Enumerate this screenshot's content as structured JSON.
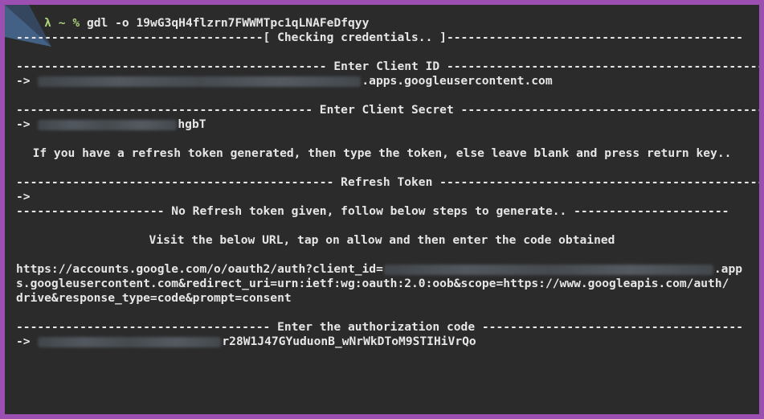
{
  "prompt": {
    "lambda": "λ",
    "tilde": "~",
    "percent": "%",
    "command": "gdl -o 19wG3qH4flzrn7FWWMTpc1qLNAFeDfqyy"
  },
  "lines": {
    "checking": "-----------------------------------[ Checking credentials.. ]------------------------------------------",
    "client_id_header": "-------------------------------------------- Enter Client ID ----------------------------------------------",
    "client_id_suffix": ".apps.googleusercontent.com",
    "client_secret_header": "------------------------------------------ Enter Client Secret --------------------------------------------",
    "client_secret_suffix": "hgbT",
    "refresh_hint": "If you have a refresh token generated, then type the token, else leave blank and press return key..",
    "refresh_header": "--------------------------------------------- Refresh Token ----------------------------------------------",
    "no_refresh": "--------------------- No Refresh token given, follow below steps to generate.. ----------------------",
    "visit_url": "Visit the below URL, tap on allow and then enter the code obtained",
    "url_line1_prefix": "https://accounts.google.com/o/oauth2/auth?client_id=",
    "url_line1_suffix": ".app",
    "url_line2": "s.googleusercontent.com&redirect_uri=urn:ietf:wg:oauth:2.0:oob&scope=https://www.googleapis.com/auth/",
    "url_line3": "drive&response_type=code&prompt=consent",
    "auth_header": "------------------------------------ Enter the authorization code -------------------------------------",
    "auth_code_suffix": "r28W1J47GYuduonB_wNrWkDToM9STIHiVrQo",
    "arrow": "->"
  },
  "colors": {
    "background": "#2b2b2b",
    "border": "#9b4fb0",
    "text": "#e6e6e6",
    "prompt": "#a9d27a"
  }
}
